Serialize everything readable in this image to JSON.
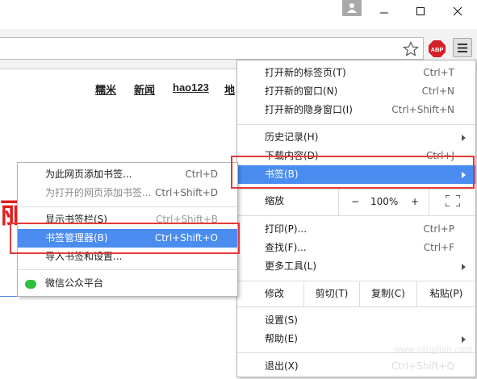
{
  "toolbar": {
    "abp_label": "ABP"
  },
  "page": {
    "links": [
      "糯米",
      "新闻",
      "hao123",
      "地"
    ],
    "red_text": "丽"
  },
  "main_menu": {
    "items": [
      {
        "label": "打开新的标签页(T)",
        "shortcut": "Ctrl+T"
      },
      {
        "label": "打开新的窗口(N)",
        "shortcut": "Ctrl+N"
      },
      {
        "label": "打开新的隐身窗口(I)",
        "shortcut": "Ctrl+Shift+N"
      },
      {
        "label": "历史记录(H)",
        "shortcut": ""
      },
      {
        "label": "下载内容(D)",
        "shortcut": "Ctrl+J"
      },
      {
        "label": "书签(B)",
        "shortcut": ""
      },
      {
        "label": "打印(P)...",
        "shortcut": "Ctrl+P"
      },
      {
        "label": "查找(F)...",
        "shortcut": "Ctrl+F"
      },
      {
        "label": "更多工具(L)",
        "shortcut": ""
      },
      {
        "label": "设置(S)",
        "shortcut": ""
      },
      {
        "label": "帮助(E)",
        "shortcut": ""
      },
      {
        "label": "退出(X)",
        "shortcut": "Ctrl+Shift+Q"
      }
    ],
    "zoom": {
      "label": "缩放",
      "minus": "−",
      "value": "100%",
      "plus": "+"
    },
    "edit": {
      "label": "修改",
      "cut": "剪切(T)",
      "copy": "复制(C)",
      "paste": "粘贴(P)"
    }
  },
  "bookmarks_submenu": {
    "items": [
      {
        "label": "为此网页添加书签...",
        "shortcut": "Ctrl+D"
      },
      {
        "label": "为打开的网页添加书签...",
        "shortcut": "Ctrl+Shift+D"
      },
      {
        "label": "显示书签栏(S)",
        "shortcut": "Ctrl+Shift+B"
      },
      {
        "label": "书签管理器(B)",
        "shortcut": "Ctrl+Shift+O"
      },
      {
        "label": "导入书签和设置...",
        "shortcut": ""
      },
      {
        "label": "微信公众平台",
        "shortcut": ""
      }
    ]
  },
  "watermark": "www.sjingjian.com",
  "colors": {
    "highlight": "#4a8cf0",
    "annotation": "#e3393a",
    "abp": "#d61f26"
  }
}
